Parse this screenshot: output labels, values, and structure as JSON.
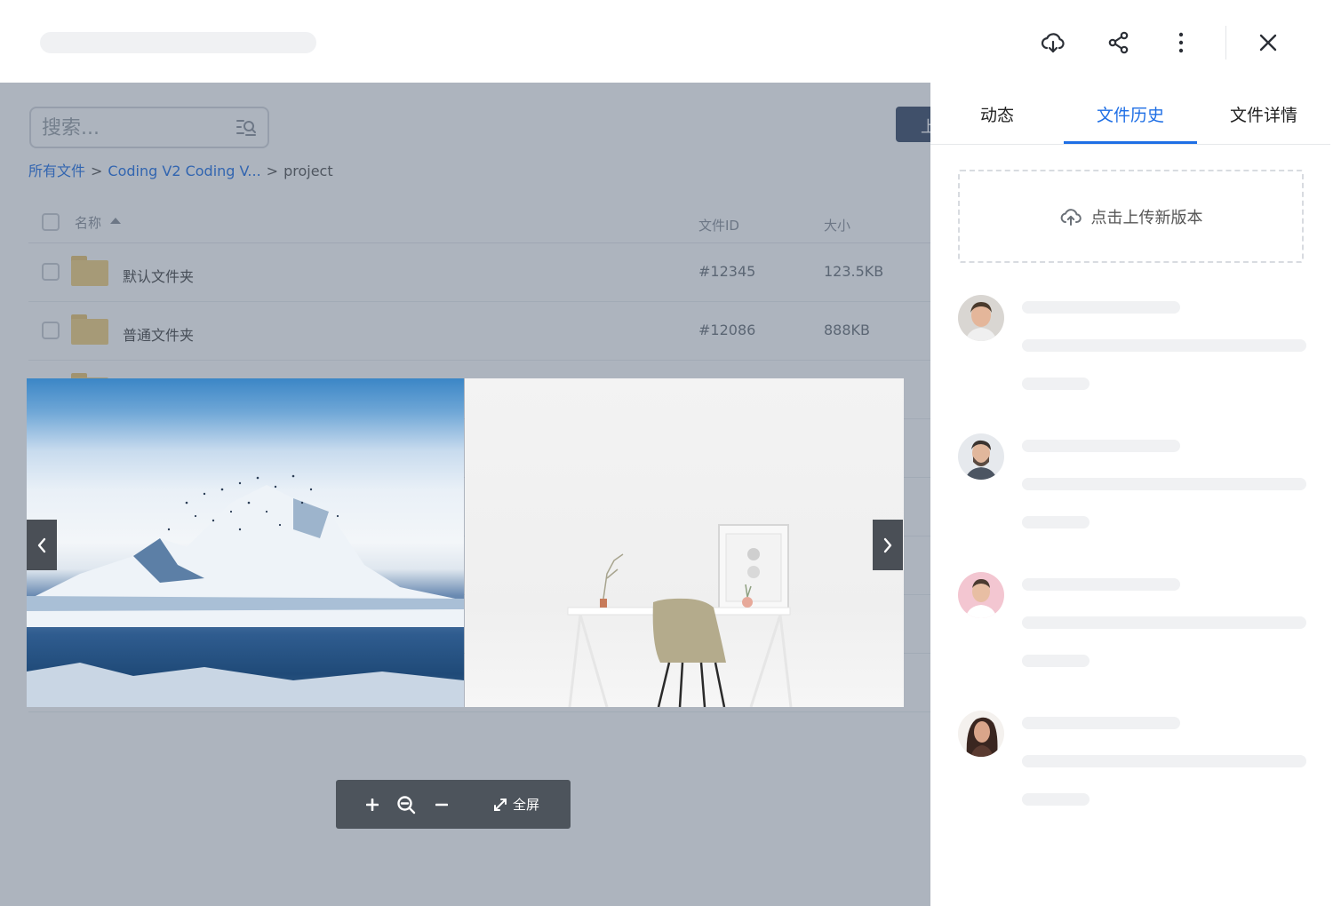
{
  "header": {
    "icons": [
      "cloud-download-icon",
      "share-icon",
      "more-vertical-icon",
      "close-icon"
    ]
  },
  "main": {
    "search": {
      "placeholder": "搜索..."
    },
    "upload_label": "上",
    "breadcrumb": {
      "root": "所有文件",
      "separator": ">",
      "middle": "Coding V2 Coding V...",
      "current": "project"
    },
    "table": {
      "columns": {
        "name": "名称",
        "id": "文件ID",
        "size": "大小"
      },
      "rows": [
        {
          "name": "默认文件夹",
          "id": "#12345",
          "size": "123.5KB"
        },
        {
          "name": "普通文件夹",
          "id": "#12086",
          "size": "888KB"
        }
      ]
    }
  },
  "viewer": {
    "toolbar": {
      "fullscreen_label": "全屏"
    }
  },
  "panel": {
    "tabs": [
      {
        "label": "动态",
        "active": false
      },
      {
        "label": "文件历史",
        "active": true
      },
      {
        "label": "文件详情",
        "active": false
      }
    ],
    "upload_new_version": "点击上传新版本"
  },
  "colors": {
    "accent": "#1f6fe5",
    "overlay": "#4a586e",
    "toolbar": "#4d545c"
  }
}
